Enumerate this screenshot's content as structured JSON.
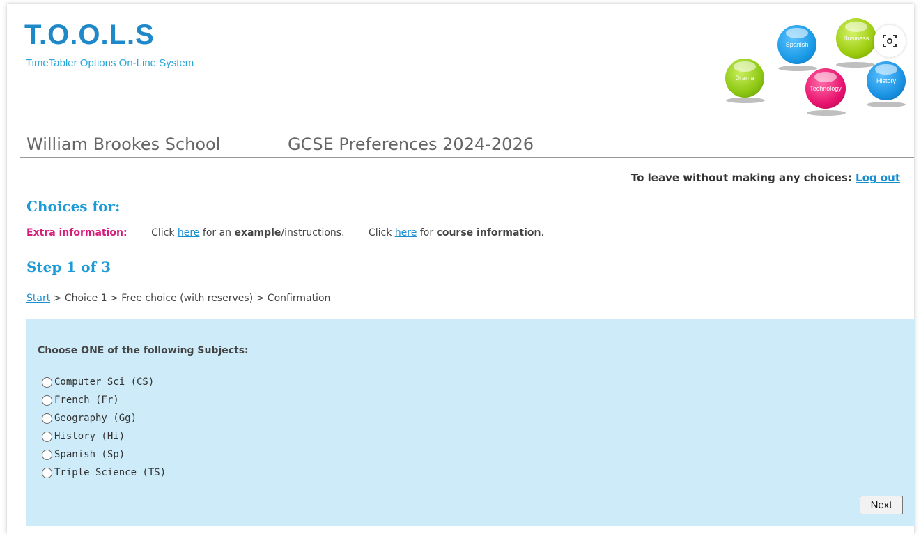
{
  "logo": {
    "title": "T.O.O.L.S",
    "subtitle": "TimeTabler Options On-Line System"
  },
  "balls": [
    {
      "label": "Spanish",
      "color": "#1a9ae6"
    },
    {
      "label": "Business",
      "color": "#9ccc0e"
    },
    {
      "label": "Drama",
      "color": "#8cc712"
    },
    {
      "label": "Technology",
      "color": "#e8136e"
    },
    {
      "label": "History",
      "color": "#1a92e2"
    }
  ],
  "header": {
    "school": "William Brookes School",
    "title": "GCSE Preferences 2024-2026"
  },
  "leave": {
    "text": "To leave without making any choices: ",
    "link": "Log out"
  },
  "choices_for": "Choices for:",
  "extra": {
    "label": "Extra information:",
    "click1": "Click ",
    "here1": "here",
    "for1": " for an ",
    "bold1": "example",
    "rest1": "/instructions.",
    "click2": "Click ",
    "here2": "here",
    "for2": " for ",
    "bold2": "course information",
    "rest2": "."
  },
  "step": "Step 1 of 3",
  "breadcrumb": {
    "start": "Start",
    "rest": " > Choice 1 > Free choice (with reserves) > Confirmation"
  },
  "form": {
    "heading": "Choose ONE of the following Subjects:",
    "options": [
      "Computer Sci (CS)",
      "French (Fr)",
      "Geography (Gg)",
      "History (Hi)",
      "Spanish (Sp)",
      "Triple Science (TS)"
    ],
    "next_label": "Next"
  },
  "colors": {
    "accent": "#1e9bd6",
    "extra_label": "#d81b7a",
    "panel_bg": "#cdebf8"
  }
}
